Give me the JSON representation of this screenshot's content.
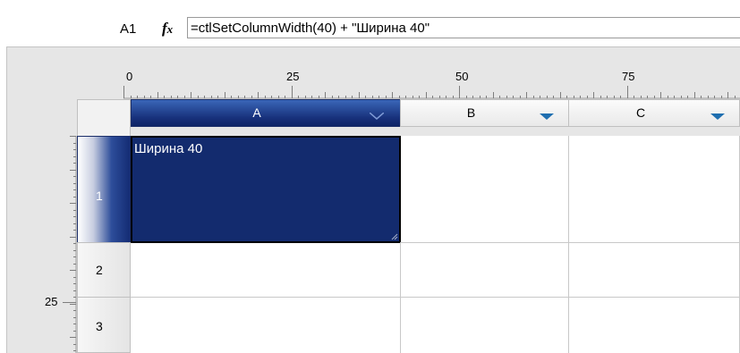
{
  "formula_bar": {
    "cell_reference": "A1",
    "fx_icon": "function-icon",
    "formula": "=ctlSetColumnWidth(40) + \"Ширина 40\""
  },
  "ruler": {
    "horizontal_labels": [
      "0",
      "25",
      "50",
      "75"
    ],
    "vertical_labels": [
      "25"
    ]
  },
  "columns": [
    {
      "label": "A",
      "selected": true,
      "dropdown_icon": "chevron-down-icon"
    },
    {
      "label": "B",
      "selected": false,
      "dropdown_icon": "dropdown-arrow-icon"
    },
    {
      "label": "C",
      "selected": false,
      "dropdown_icon": "dropdown-arrow-icon"
    }
  ],
  "rows": [
    {
      "label": "1",
      "selected": true
    },
    {
      "label": "2",
      "selected": false
    },
    {
      "label": "3",
      "selected": false
    }
  ],
  "cells": {
    "A1": "Ширина 40"
  },
  "colors": {
    "selection": "#132b6e",
    "dropdown_arrow": "#1f6fb0",
    "grid_line": "#c8c8c8"
  }
}
